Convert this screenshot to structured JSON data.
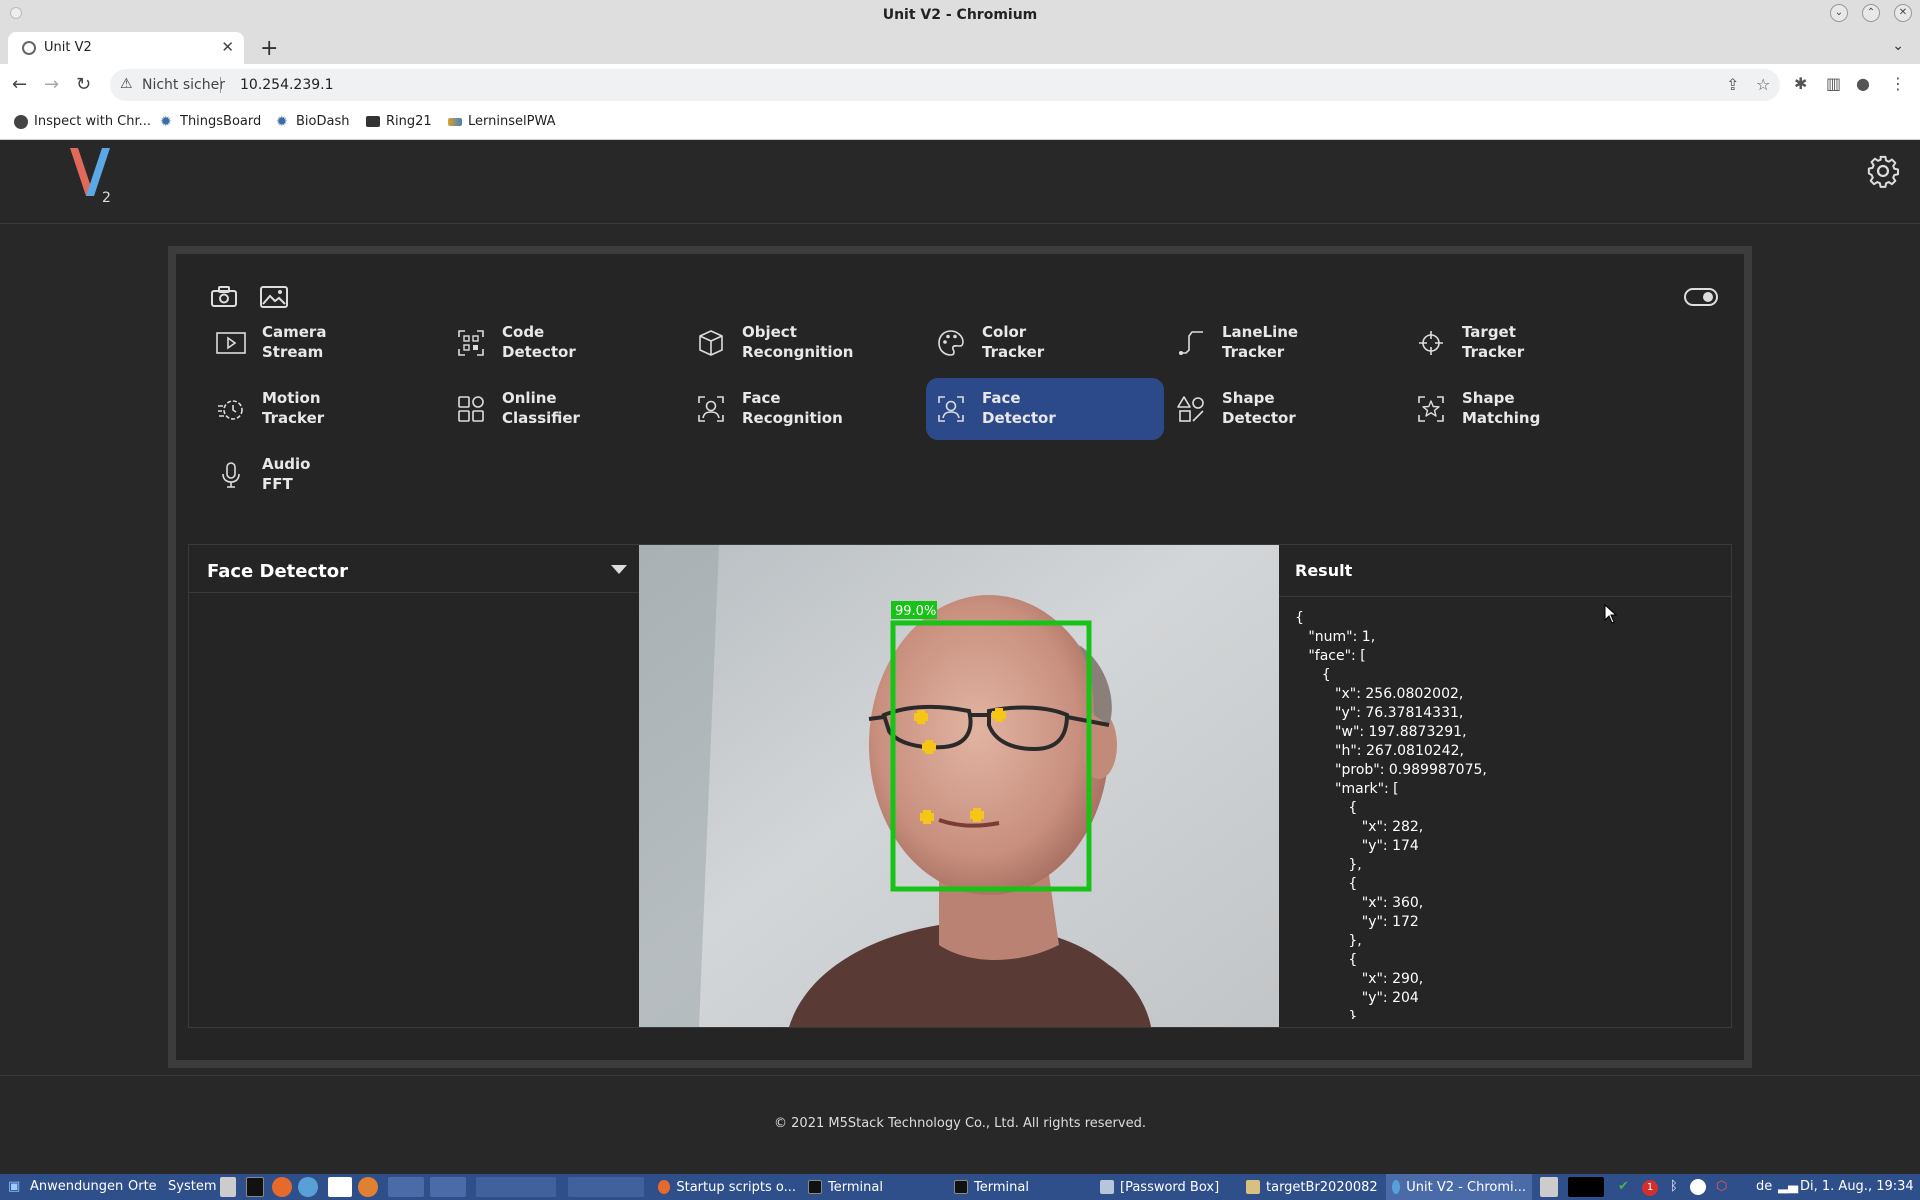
{
  "window": {
    "title": "Unit V2 - Chromium"
  },
  "tab": {
    "label": "Unit V2"
  },
  "address": {
    "security": "Nicht sicher",
    "url": "10.254.239.1"
  },
  "bookmarks": [
    {
      "label": "Inspect with Chr..."
    },
    {
      "label": "ThingsBoard"
    },
    {
      "label": "BioDash"
    },
    {
      "label": "Ring21"
    },
    {
      "label": "LerninselPWA"
    }
  ],
  "app": {
    "logo_letter": "V",
    "logo_sub": "2"
  },
  "menu": [
    {
      "line1": "Camera",
      "line2": "Stream",
      "icon": "play-icon",
      "active": false
    },
    {
      "line1": "Code",
      "line2": "Detector",
      "icon": "qr-code-icon",
      "active": false
    },
    {
      "line1": "Object",
      "line2": "Recongnition",
      "icon": "cube-icon",
      "active": false
    },
    {
      "line1": "Color",
      "line2": "Tracker",
      "icon": "palette-icon",
      "active": false
    },
    {
      "line1": "LaneLine",
      "line2": "Tracker",
      "icon": "lane-icon",
      "active": false
    },
    {
      "line1": "Target",
      "line2": "Tracker",
      "icon": "crosshair-icon",
      "active": false
    },
    {
      "line1": "Motion",
      "line2": "Tracker",
      "icon": "motion-icon",
      "active": false
    },
    {
      "line1": "Online",
      "line2": "Classifier",
      "icon": "grid-icon",
      "active": false
    },
    {
      "line1": "Face",
      "line2": "Recognition",
      "icon": "face-scan-icon",
      "active": false
    },
    {
      "line1": "Face",
      "line2": "Detector",
      "icon": "face-scan-icon",
      "active": true
    },
    {
      "line1": "Shape",
      "line2": "Detector",
      "icon": "shapes-icon",
      "active": false
    },
    {
      "line1": "Shape",
      "line2": "Matching",
      "icon": "star-scan-icon",
      "active": false
    },
    {
      "line1": "Audio",
      "line2": "FFT",
      "icon": "microphone-icon",
      "active": false
    }
  ],
  "detector": {
    "title": "Face Detector",
    "confidence_label": "99.0%",
    "result_title": "Result",
    "result_text": "{\n   \"num\": 1,\n   \"face\": [\n      {\n         \"x\": 256.0802002,\n         \"y\": 76.37814331,\n         \"w\": 197.8873291,\n         \"h\": 267.0810242,\n         \"prob\": 0.989987075,\n         \"mark\": [\n            {\n               \"x\": 282,\n               \"y\": 174\n            },\n            {\n               \"x\": 360,\n               \"y\": 172\n            },\n            {\n               \"x\": 290,\n               \"y\": 204\n            },"
  },
  "footer": {
    "copyright": "© 2021 M5Stack Technology Co., Ltd. All rights reserved."
  },
  "taskbar": {
    "menu_apps": "Anwendungen",
    "menu_places": "Orte",
    "menu_system": "System",
    "tasks": [
      {
        "label": "Startup scripts o..."
      },
      {
        "label": "Terminal"
      },
      {
        "label": "Terminal"
      },
      {
        "label": "[Password Box]"
      },
      {
        "label": "targetBr2020082"
      },
      {
        "label": "Unit V2 - Chromi..."
      }
    ],
    "keyboard": "de",
    "clock": "Di, 1. Aug., 19:34",
    "badge": "1"
  },
  "colors": {
    "accent": "#2c4a8a",
    "detection_box": "#16c316",
    "landmark": "#f5c518"
  }
}
